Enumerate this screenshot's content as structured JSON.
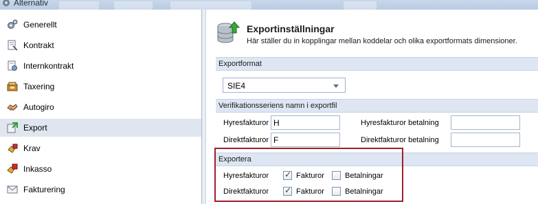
{
  "window": {
    "title": "Alternativ"
  },
  "sidebar": {
    "items": [
      {
        "label": "Generellt",
        "icon": "gear-icon"
      },
      {
        "label": "Kontrakt",
        "icon": "contract-icon"
      },
      {
        "label": "Internkontrakt",
        "icon": "internal-contract-icon"
      },
      {
        "label": "Taxering",
        "icon": "taxation-icon"
      },
      {
        "label": "Autogiro",
        "icon": "handshake-icon"
      },
      {
        "label": "Export",
        "icon": "export-icon",
        "selected": true
      },
      {
        "label": "Krav",
        "icon": "demand-icon"
      },
      {
        "label": "Inkasso",
        "icon": "collection-icon"
      },
      {
        "label": "Fakturering",
        "icon": "envelope-icon"
      }
    ]
  },
  "header": {
    "title": "Exportinställningar",
    "subtitle": "Här ställer du in kopplingar mellan koddelar och olika exportformats dimensioner."
  },
  "export_format": {
    "section_label": "Exportformat",
    "selected": "SIE4"
  },
  "series": {
    "section_label": "Verifikationsseriens namn i exportfil",
    "hyresfakturor_label": "Hyresfakturor",
    "hyresfakturor_value": "H",
    "direktfakturor_label": "Direktfakturor",
    "direktfakturor_value": "F",
    "hyres_betalning_label": "Hyresfakturor betalning",
    "hyres_betalning_value": "",
    "direkt_betalning_label": "Direktfakturor betalning",
    "direkt_betalning_value": ""
  },
  "exportera": {
    "section_label": "Exportera",
    "rows": [
      {
        "label": "Hyresfakturor",
        "fakturor_label": "Fakturor",
        "fakturor_checked": true,
        "betalningar_label": "Betalningar",
        "betalningar_checked": false
      },
      {
        "label": "Direktfakturor",
        "fakturor_label": "Fakturor",
        "fakturor_checked": true,
        "betalningar_label": "Betalningar",
        "betalningar_checked": false
      }
    ]
  },
  "colors": {
    "highlight_border": "#a01d2a",
    "section_header_bg": "#dde6f2",
    "selected_item_bg": "#dfe6ef"
  }
}
